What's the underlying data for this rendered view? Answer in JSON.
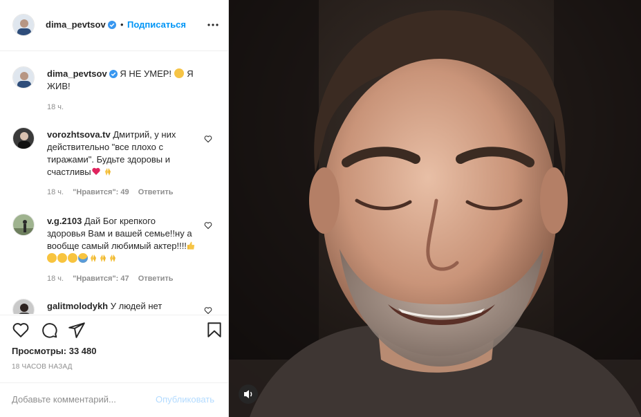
{
  "header": {
    "username": "dima_pevtsov",
    "dot": "•",
    "follow_label": "Подписаться"
  },
  "caption": {
    "username": "dima_pevtsov",
    "text_a": "Я НЕ УМЕР!",
    "text_b": "Я ЖИВ!",
    "time": "18 ч."
  },
  "comments": [
    {
      "username": "vorozhtsova.tv",
      "text": "Дмитрий, у них действительно \"все плохо с тиражами\". Будьте здоровы и счастливы",
      "time": "18 ч.",
      "likes": "\"Нравится\": 49",
      "reply": "Ответить"
    },
    {
      "username": "v.g.2103",
      "text": "Дай Бог крепкого здоровья Вам и вашей семье!!ну а вообще самый любимый актер!!!!",
      "time": "18 ч.",
      "likes": "\"Нравится\": 47",
      "reply": "Ответить"
    },
    {
      "username": "galitmolodykh",
      "text": "У людей нет"
    }
  ],
  "stats": {
    "views_label": "Просмотры:",
    "views_value": "33 480",
    "ago": "18 ЧАСОВ НАЗАД"
  },
  "composer": {
    "placeholder": "Добавьте комментарий...",
    "publish": "Опубликовать"
  },
  "colors": {
    "accent": "#0095f6",
    "verified": "#3897f0",
    "muted": "#8e8e8e",
    "publish_disabled": "#b3dbff"
  }
}
